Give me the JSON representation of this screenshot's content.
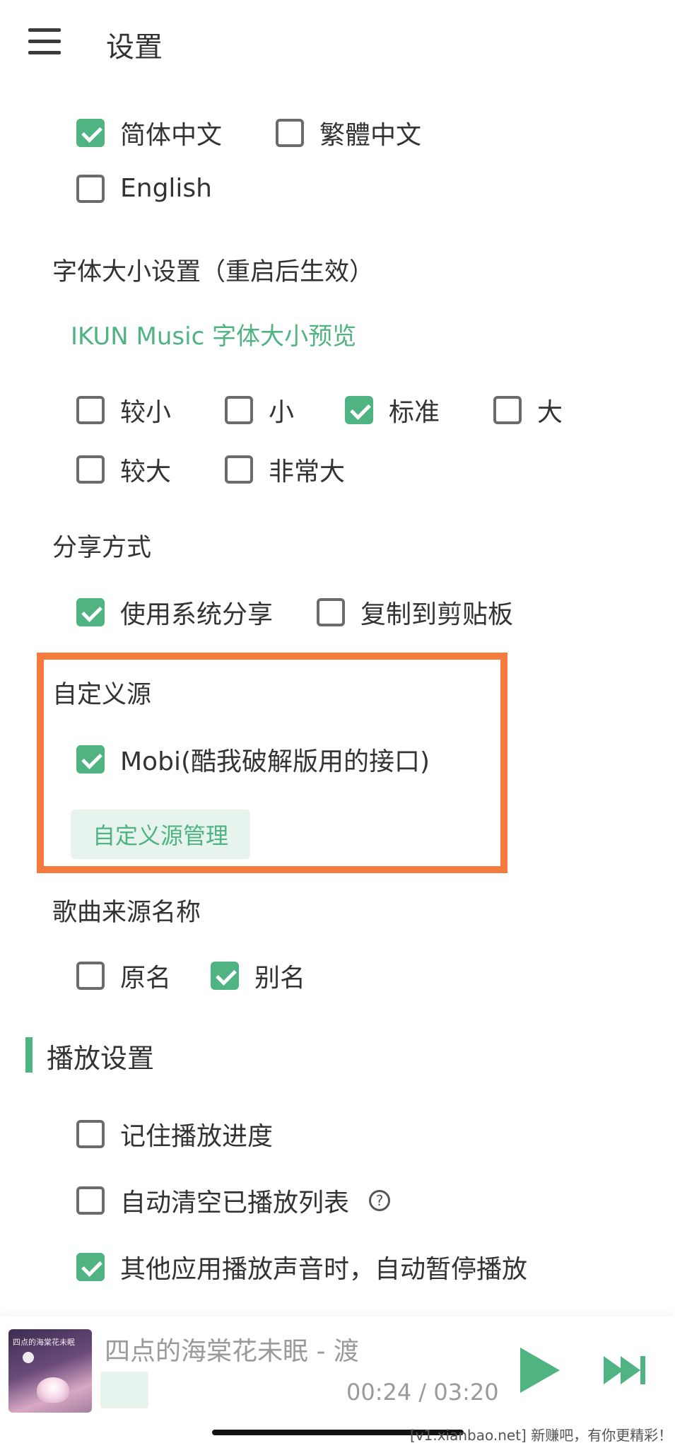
{
  "header": {
    "menu_icon": "hamburger-menu-icon",
    "title": "设置"
  },
  "language": {
    "options": [
      {
        "label": "简体中文",
        "checked": true
      },
      {
        "label": "繁體中文",
        "checked": false
      },
      {
        "label": "English",
        "checked": false
      }
    ]
  },
  "font_size": {
    "heading": "字体大小设置（重启后生效）",
    "preview": "IKUN Music 字体大小预览",
    "options": [
      {
        "label": "较小",
        "checked": false
      },
      {
        "label": "小",
        "checked": false
      },
      {
        "label": "标准",
        "checked": true
      },
      {
        "label": "大",
        "checked": false
      },
      {
        "label": "较大",
        "checked": false
      },
      {
        "label": "非常大",
        "checked": false
      }
    ]
  },
  "share": {
    "heading": "分享方式",
    "options": [
      {
        "label": "使用系统分享",
        "checked": true
      },
      {
        "label": "复制到剪贴板",
        "checked": false
      }
    ]
  },
  "custom_source": {
    "heading": "自定义源",
    "option": {
      "label": "Mobi(酷我破解版用的接口)",
      "checked": true
    },
    "manage_button": "自定义源管理",
    "highlight_color": "#f57a3e"
  },
  "song_source_name": {
    "heading": "歌曲来源名称",
    "options": [
      {
        "label": "原名",
        "checked": false
      },
      {
        "label": "别名",
        "checked": true
      }
    ]
  },
  "playback": {
    "heading": "播放设置",
    "options": [
      {
        "label": "记住播放进度",
        "checked": false
      },
      {
        "label": "自动清空已播放列表",
        "checked": false,
        "help_icon": "question-circle-icon"
      },
      {
        "label": "其他应用播放声音时，自动暂停播放",
        "checked": true
      }
    ]
  },
  "player": {
    "song_title": "四点的海棠花未眠 - 渡",
    "cover_text": "四点的海棠花未眠",
    "current_time": "00:24",
    "total_time": "03:20",
    "time_display": "00:24 / 03:20",
    "play_icon": "play-icon",
    "next_icon": "skip-next-icon"
  },
  "watermark": "[v1.xianbao.net] 新赚吧，有你更精彩！",
  "colors": {
    "accent": "#4fb382",
    "highlight": "#f57a3e",
    "text": "#333333"
  }
}
